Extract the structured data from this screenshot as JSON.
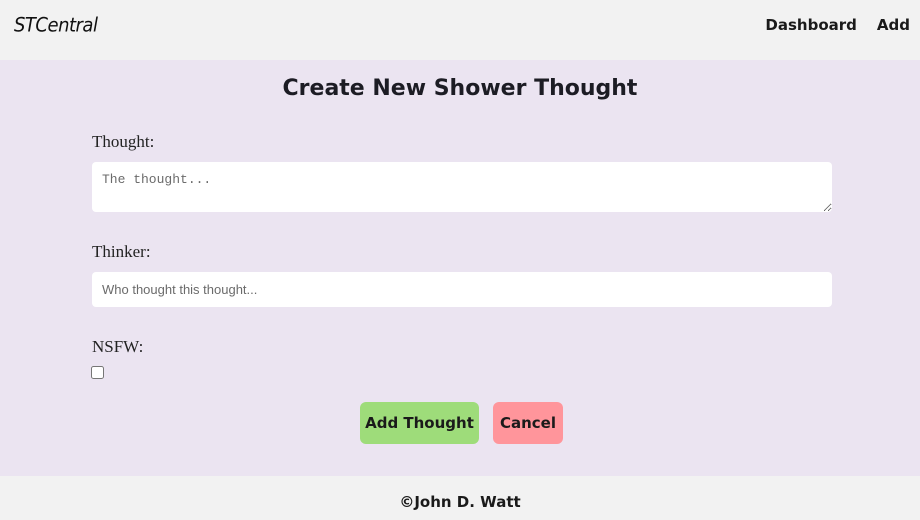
{
  "navbar": {
    "brand": "STCentral",
    "links": [
      "Dashboard",
      "Add"
    ]
  },
  "form": {
    "title": "Create New Shower Thought",
    "thought": {
      "label": "Thought:",
      "placeholder": "The thought...",
      "value": ""
    },
    "thinker": {
      "label": "Thinker:",
      "placeholder": "Who thought this thought...",
      "value": ""
    },
    "nsfw": {
      "label": "NSFW:",
      "checked": false
    },
    "buttons": {
      "submit": "Add Thought",
      "cancel": "Cancel"
    }
  },
  "footer": {
    "text": "©John D. Watt"
  },
  "colors": {
    "background": "#ebe4f1",
    "navbar": "#f2f2f2",
    "submit_button": "#9edc7a",
    "cancel_button": "#ff959b"
  }
}
